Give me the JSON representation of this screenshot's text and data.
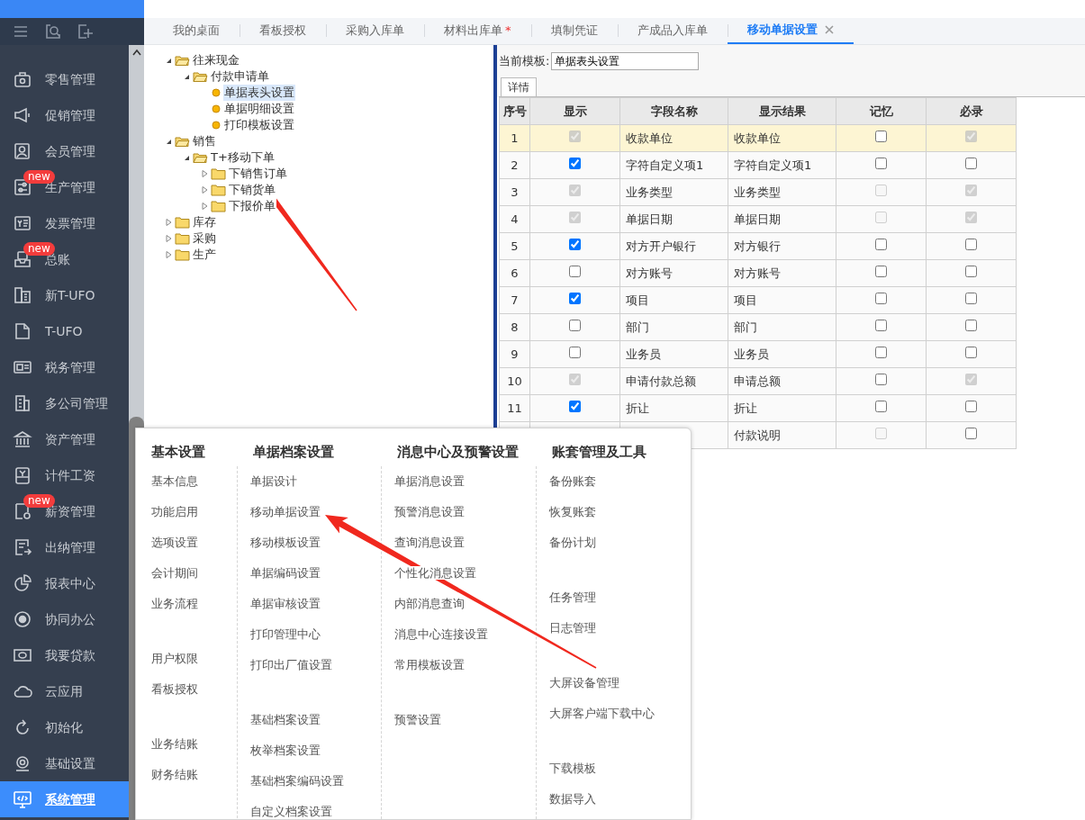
{
  "sidebar": {
    "items": [
      {
        "label": "零售管理",
        "selected": false
      },
      {
        "label": "促销管理",
        "selected": false
      },
      {
        "label": "会员管理",
        "selected": false
      },
      {
        "label": "生产管理",
        "selected": false,
        "badge": "new"
      },
      {
        "label": "发票管理",
        "selected": false
      },
      {
        "label": "总账",
        "selected": false,
        "badge": "new"
      },
      {
        "label": "新T-UFO",
        "selected": false
      },
      {
        "label": "T-UFO",
        "selected": false
      },
      {
        "label": "税务管理",
        "selected": false
      },
      {
        "label": "多公司管理",
        "selected": false
      },
      {
        "label": "资产管理",
        "selected": false
      },
      {
        "label": "计件工资",
        "selected": false
      },
      {
        "label": "薪资管理",
        "selected": false,
        "badge": "new"
      },
      {
        "label": "出纳管理",
        "selected": false
      },
      {
        "label": "报表中心",
        "selected": false
      },
      {
        "label": "协同办公",
        "selected": false
      },
      {
        "label": "我要贷款",
        "selected": false
      },
      {
        "label": "云应用",
        "selected": false
      },
      {
        "label": "初始化",
        "selected": false
      },
      {
        "label": "基础设置",
        "selected": false
      },
      {
        "label": "系统管理",
        "selected": true
      }
    ]
  },
  "tabs": [
    {
      "label": "我的桌面",
      "selected": false
    },
    {
      "label": "看板授权",
      "selected": false
    },
    {
      "label": "采购入库单",
      "selected": false
    },
    {
      "label": "材料出库单",
      "selected": false,
      "marker": "*"
    },
    {
      "label": "填制凭证",
      "selected": false
    },
    {
      "label": "产成品入库单",
      "selected": false
    },
    {
      "label": "移动单据设置",
      "selected": true
    }
  ],
  "tree": [
    {
      "label": "往来现金",
      "kind": "folder",
      "expanded": true,
      "selected": false,
      "children": [
        {
          "label": "付款申请单",
          "kind": "folder",
          "expanded": true,
          "selected": false,
          "children": [
            {
              "label": "单据表头设置",
              "kind": "leaf",
              "selected": true
            },
            {
              "label": "单据明细设置",
              "kind": "leaf",
              "selected": false
            },
            {
              "label": "打印模板设置",
              "kind": "leaf",
              "selected": false
            }
          ]
        }
      ]
    },
    {
      "label": "销售",
      "kind": "folder",
      "expanded": true,
      "selected": false,
      "children": [
        {
          "label": "T+移动下单",
          "kind": "folder",
          "expanded": true,
          "selected": false,
          "children": [
            {
              "label": "下销售订单",
              "kind": "folder",
              "expanded": false,
              "selected": false
            },
            {
              "label": "下销货单",
              "kind": "folder",
              "expanded": false,
              "selected": false
            },
            {
              "label": "下报价单",
              "kind": "folder",
              "expanded": false,
              "selected": false
            }
          ]
        }
      ]
    },
    {
      "label": "库存",
      "kind": "folder",
      "expanded": false,
      "selected": false
    },
    {
      "label": "采购",
      "kind": "folder",
      "expanded": false,
      "selected": false
    },
    {
      "label": "生产",
      "kind": "folder",
      "expanded": false,
      "selected": false
    }
  ],
  "template": {
    "label": "当前模板:",
    "value": "单据表头设置"
  },
  "detail_tab": {
    "label": "详情",
    "selected": true
  },
  "table": {
    "columns": [
      "序号",
      "显示",
      "字段名称",
      "显示结果",
      "记忆",
      "必录"
    ],
    "rows": [
      {
        "index": "1",
        "selected": true,
        "show": {
          "checked": true,
          "disabled": true
        },
        "field": "收款单位",
        "result": "收款单位",
        "memory": {
          "checked": false,
          "disabled": false
        },
        "required": {
          "checked": true,
          "disabled": true
        }
      },
      {
        "index": "2",
        "selected": false,
        "show": {
          "checked": true,
          "disabled": false
        },
        "field": "字符自定义项1",
        "result": "字符自定义项1",
        "memory": {
          "checked": false,
          "disabled": false
        },
        "required": {
          "checked": false,
          "disabled": false
        }
      },
      {
        "index": "3",
        "selected": false,
        "show": {
          "checked": true,
          "disabled": true
        },
        "field": "业务类型",
        "result": "业务类型",
        "memory": {
          "checked": false,
          "disabled": true
        },
        "required": {
          "checked": true,
          "disabled": true
        }
      },
      {
        "index": "4",
        "selected": false,
        "show": {
          "checked": true,
          "disabled": true
        },
        "field": "单据日期",
        "result": "单据日期",
        "memory": {
          "checked": false,
          "disabled": true
        },
        "required": {
          "checked": true,
          "disabled": true
        }
      },
      {
        "index": "5",
        "selected": false,
        "show": {
          "checked": true,
          "disabled": false
        },
        "field": "对方开户银行",
        "result": "对方银行",
        "memory": {
          "checked": false,
          "disabled": false
        },
        "required": {
          "checked": false,
          "disabled": false
        }
      },
      {
        "index": "6",
        "selected": false,
        "show": {
          "checked": false,
          "disabled": false
        },
        "field": "对方账号",
        "result": "对方账号",
        "memory": {
          "checked": false,
          "disabled": false
        },
        "required": {
          "checked": false,
          "disabled": false
        }
      },
      {
        "index": "7",
        "selected": false,
        "show": {
          "checked": true,
          "disabled": false
        },
        "field": "项目",
        "result": "项目",
        "memory": {
          "checked": false,
          "disabled": false
        },
        "required": {
          "checked": false,
          "disabled": false
        }
      },
      {
        "index": "8",
        "selected": false,
        "show": {
          "checked": false,
          "disabled": false
        },
        "field": "部门",
        "result": "部门",
        "memory": {
          "checked": false,
          "disabled": false
        },
        "required": {
          "checked": false,
          "disabled": false
        }
      },
      {
        "index": "9",
        "selected": false,
        "show": {
          "checked": false,
          "disabled": false
        },
        "field": "业务员",
        "result": "业务员",
        "memory": {
          "checked": false,
          "disabled": false
        },
        "required": {
          "checked": false,
          "disabled": false
        }
      },
      {
        "index": "10",
        "selected": false,
        "show": {
          "checked": true,
          "disabled": true
        },
        "field": "申请付款总额",
        "result": "申请总额",
        "memory": {
          "checked": false,
          "disabled": false
        },
        "required": {
          "checked": true,
          "disabled": true
        }
      },
      {
        "index": "11",
        "selected": false,
        "show": {
          "checked": true,
          "disabled": false
        },
        "field": "折让",
        "result": "折让",
        "memory": {
          "checked": false,
          "disabled": false
        },
        "required": {
          "checked": false,
          "disabled": false
        }
      },
      {
        "selected": false,
        "result": "付款说明",
        "memory": {
          "checked": false,
          "disabled": true
        },
        "required": {
          "checked": false,
          "disabled": false
        }
      }
    ]
  },
  "menu": {
    "columns": [
      {
        "title": "基本设置",
        "groups": [
          [
            "基本信息",
            "功能启用",
            "选项设置",
            "会计期间",
            "业务流程"
          ],
          [
            "用户权限",
            "看板授权"
          ],
          [
            "业务结账",
            "财务结账"
          ]
        ]
      },
      {
        "title": "单据档案设置",
        "groups": [
          [
            "单据设计",
            "移动单据设置",
            "移动模板设置",
            "单据编码设置",
            "单据审核设置",
            "打印管理中心",
            "打印出厂值设置"
          ],
          [
            "基础档案设置",
            "枚举档案设置",
            "基础档案编码设置",
            "自定义档案设置"
          ]
        ]
      },
      {
        "title": "消息中心及预警设置",
        "groups": [
          [
            "单据消息设置",
            "预警消息设置",
            "查询消息设置",
            "个性化消息设置",
            "内部消息查询",
            "消息中心连接设置",
            "常用模板设置"
          ],
          [
            "预警设置"
          ]
        ]
      },
      {
        "title": "账套管理及工具",
        "groups": [
          [
            "备份账套",
            "恢复账套",
            "备份计划"
          ],
          [
            "任务管理",
            "日志管理"
          ],
          [
            "大屏设备管理",
            "大屏客户端下载中心"
          ],
          [
            "下载模板",
            "数据导入"
          ]
        ]
      }
    ]
  }
}
